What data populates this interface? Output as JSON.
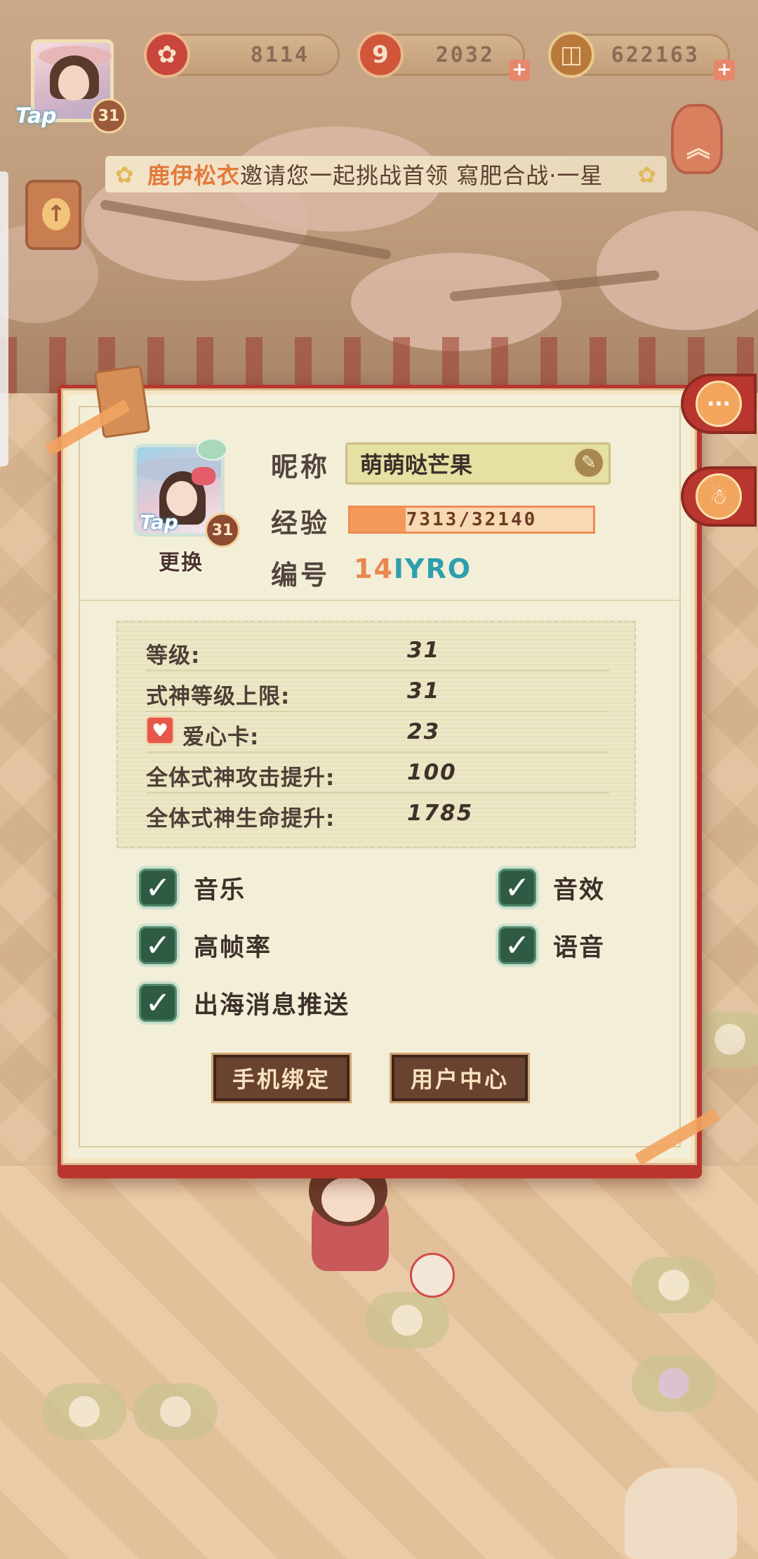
{
  "hud": {
    "avatar_tap": "Tap",
    "avatar_level": "31",
    "currencies": [
      {
        "name": "stamina",
        "icon": "flower-icon",
        "value": "8114",
        "color": "#c8463b"
      },
      {
        "name": "magatama",
        "icon": "magatama-icon",
        "value": "2032",
        "color": "#d0563a"
      },
      {
        "name": "coins",
        "icon": "coin-icon",
        "value": "622163",
        "color": "#b9793a"
      }
    ]
  },
  "banner": {
    "name": "鹿伊松衣",
    "text": "邀请您一起挑战首领 寫肥合战·一星"
  },
  "profile": {
    "tap": "Tap",
    "level": "31",
    "change_label": "更换",
    "nickname_label": "昵称",
    "nickname": "萌萌哒芒果",
    "exp_label": "经验",
    "exp_text": "7313/32140",
    "exp_fraction": 0.2275,
    "id_label": "编号",
    "id_part1": "14",
    "id_part2": "IYRO"
  },
  "stats": [
    {
      "label": "等级:",
      "value": "31"
    },
    {
      "label": "式神等级上限:",
      "value": "31"
    },
    {
      "label": "爱心卡:",
      "value": "23",
      "icon": "heart-icon"
    },
    {
      "label": "全体式神攻击提升:",
      "value": "100"
    },
    {
      "label": "全体式神生命提升:",
      "value": "1785"
    }
  ],
  "toggles": {
    "music": {
      "label": "音乐",
      "checked": true
    },
    "sfx": {
      "label": "音效",
      "checked": true
    },
    "high_fps": {
      "label": "高帧率",
      "checked": true
    },
    "voice": {
      "label": "语音",
      "checked": true
    },
    "push": {
      "label": "出海消息推送",
      "checked": true
    }
  },
  "buttons": {
    "bind_phone": "手机绑定",
    "user_center": "用户中心"
  },
  "colors": {
    "panel": "#f3eed7",
    "panel_frame": "#b8362d",
    "accent_orange": "#ef8b53",
    "check_green": "#2f5a44"
  }
}
